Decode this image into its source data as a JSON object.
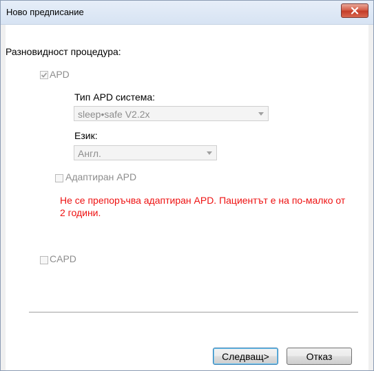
{
  "window": {
    "title": "Ново предписание"
  },
  "procedure": {
    "heading": "Разновидност процедура:",
    "apd": {
      "label": "APD",
      "checked": true,
      "system_label": "Тип APD система:",
      "system_value": "sleep•safe V2.2x",
      "language_label": "Език:",
      "language_value": "Англ.",
      "adapted_label": "Адаптиран APD",
      "adapted_checked": false,
      "warning": "Не се препоръчва адаптиран APD. Пациентът е на по-малко от 2 години."
    },
    "capd": {
      "label": "CAPD",
      "checked": false
    }
  },
  "buttons": {
    "next_label": "Следващ>",
    "cancel_label": "Отказ"
  },
  "colors": {
    "warning": "#ee1111",
    "disabled_text": "#8d8d8d"
  }
}
